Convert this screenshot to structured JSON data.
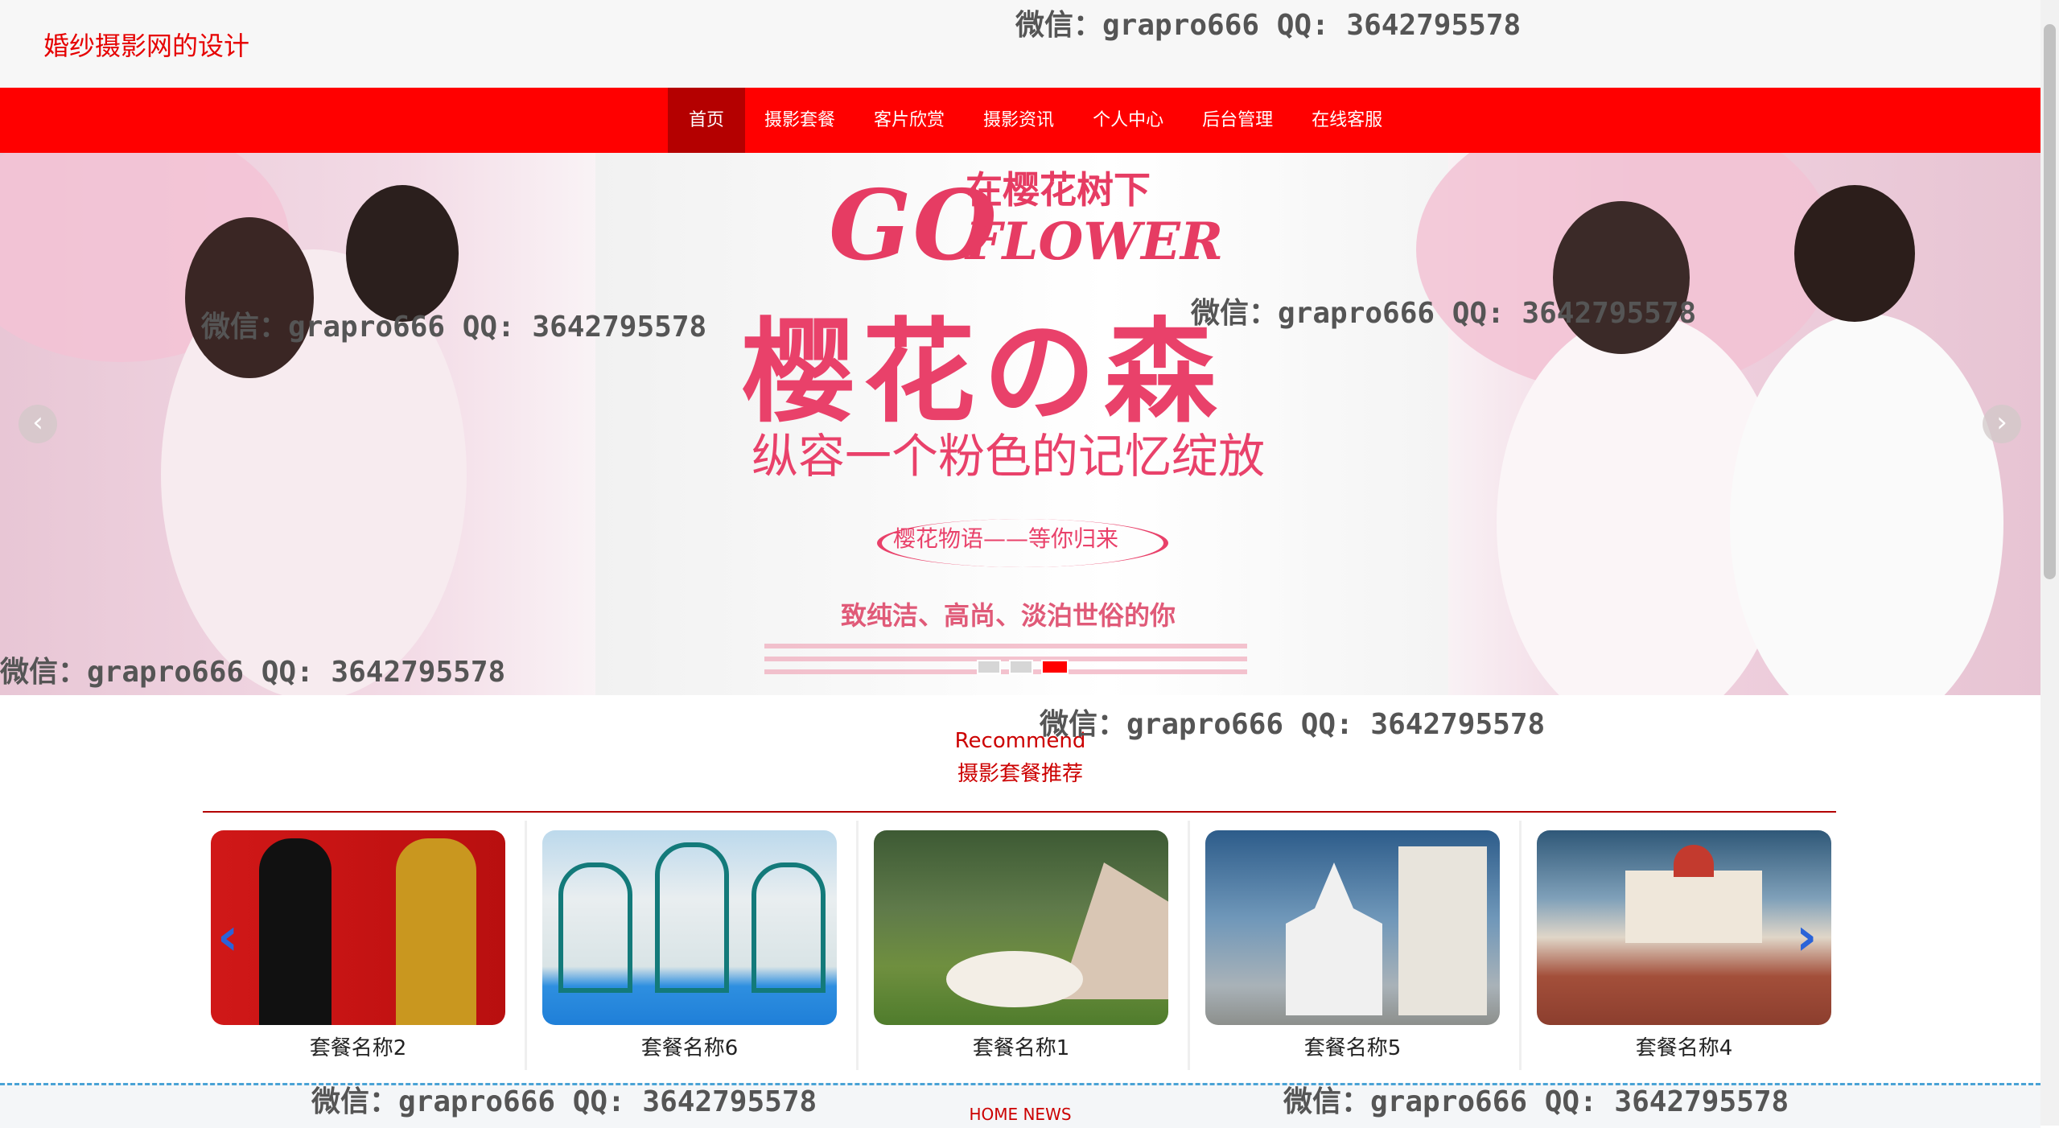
{
  "header": {
    "site_title": "婚纱摄影网的设计"
  },
  "nav": {
    "items": [
      "首页",
      "摄影套餐",
      "客片欣赏",
      "摄影资讯",
      "个人中心",
      "后台管理",
      "在线客服"
    ]
  },
  "banner": {
    "head_go": "GO",
    "head_cn_small": "在樱花树下",
    "head_flower": "FLOWER",
    "head_main": "樱花の森",
    "head_sub": "纵容一个粉色的记忆绽放",
    "head_tag": "樱花物语——等你归来",
    "head_line": "致纯洁、高尚、淡泊世俗的你",
    "prev_icon": "‹",
    "next_icon": "›"
  },
  "recommend": {
    "title_en": "Recommend",
    "title_cn": "摄影套餐推荐",
    "cards": [
      {
        "name": "套餐名称2",
        "theme": "red-chinese"
      },
      {
        "name": "套餐名称6",
        "theme": "pool-tiles"
      },
      {
        "name": "套餐名称1",
        "theme": "garden"
      },
      {
        "name": "套餐名称5",
        "theme": "church"
      },
      {
        "name": "套餐名称4",
        "theme": "manor"
      }
    ],
    "prev_icon": "‹",
    "next_icon": "›"
  },
  "news": {
    "title": "HOME NEWS"
  },
  "watermark": "微信：grapro666 QQ: 3642795578",
  "colors": {
    "primary": "#ff0000",
    "active_nav": "#b40000",
    "text_red": "#cc0000"
  }
}
